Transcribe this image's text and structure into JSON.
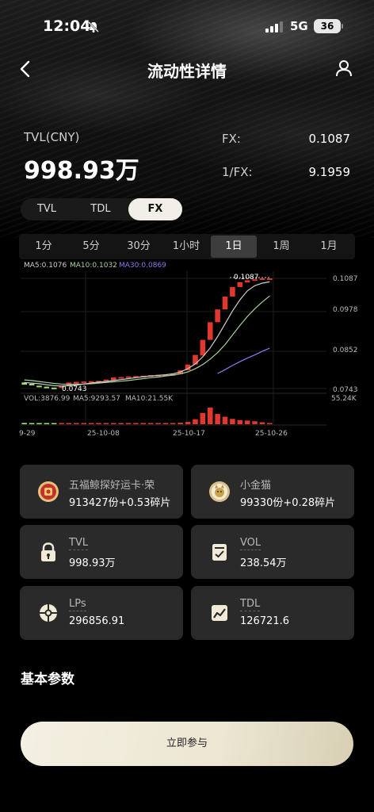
{
  "status_bar": {
    "time": "12:04",
    "network": "5G",
    "battery": "36"
  },
  "header": {
    "title": "流动性详情"
  },
  "stats": {
    "tvl_label": "TVL(CNY)",
    "tvl_value": "998.93万",
    "fx_label": "FX:",
    "fx_value": "0.1087",
    "inv_fx_label": "1/FX:",
    "inv_fx_value": "9.1959"
  },
  "segment_tabs": [
    {
      "label": "TVL",
      "active": false
    },
    {
      "label": "TDL",
      "active": false
    },
    {
      "label": "FX",
      "active": true
    }
  ],
  "intervals": [
    {
      "label": "1分",
      "active": false
    },
    {
      "label": "5分",
      "active": false
    },
    {
      "label": "30分",
      "active": false
    },
    {
      "label": "1小时",
      "active": false
    },
    {
      "label": "1日",
      "active": true
    },
    {
      "label": "1周",
      "active": false
    },
    {
      "label": "1月",
      "active": false
    }
  ],
  "chart_data": {
    "type": "candlestick",
    "colors": {
      "up": "#e0382f",
      "down": "#9be36a",
      "ma5": "#cfcfcf",
      "ma10": "#a6d39a",
      "ma30": "#8c7cf0",
      "grid": "#1e1e1e"
    },
    "ma_legend": {
      "ma5": "MA5:0.1076",
      "ma10": "MA10:0.1032",
      "ma30": "MA30:0.0869"
    },
    "y_ticks": [
      "0.1087",
      "0.0978",
      "0.0852",
      "0.0743"
    ],
    "ylim": [
      0.0743,
      0.1087
    ],
    "max_label": "0.1087",
    "min_label": "0.0743",
    "volume_legend": {
      "vol": "VOL:3876.99",
      "ma5": "MA5:9293.57",
      "ma10": "MA10:21.55K"
    },
    "volume_max_label": "55.24K",
    "x_ticks": [
      "9-29",
      "25-10-08",
      "25-10-17",
      "25-10-26"
    ],
    "candles": [
      {
        "o": 0.0762,
        "c": 0.0755
      },
      {
        "o": 0.0758,
        "c": 0.0753
      },
      {
        "o": 0.0752,
        "c": 0.0747
      },
      {
        "o": 0.0749,
        "c": 0.0745
      },
      {
        "o": 0.0746,
        "c": 0.0744
      },
      {
        "o": 0.0745,
        "c": 0.0751
      },
      {
        "o": 0.0752,
        "c": 0.0762
      },
      {
        "o": 0.0758,
        "c": 0.0764
      },
      {
        "o": 0.0762,
        "c": 0.0765
      },
      {
        "o": 0.0764,
        "c": 0.0766
      },
      {
        "o": 0.0765,
        "c": 0.0767
      },
      {
        "o": 0.0766,
        "c": 0.0771
      },
      {
        "o": 0.0769,
        "c": 0.0778
      },
      {
        "o": 0.0776,
        "c": 0.0779
      },
      {
        "o": 0.0777,
        "c": 0.0781
      },
      {
        "o": 0.0779,
        "c": 0.0782
      },
      {
        "o": 0.0781,
        "c": 0.0783
      },
      {
        "o": 0.0782,
        "c": 0.0785
      },
      {
        "o": 0.0784,
        "c": 0.0786
      },
      {
        "o": 0.0785,
        "c": 0.0787
      },
      {
        "o": 0.0786,
        "c": 0.0788
      },
      {
        "o": 0.0788,
        "c": 0.08
      },
      {
        "o": 0.08,
        "c": 0.0818
      },
      {
        "o": 0.0818,
        "c": 0.0848
      },
      {
        "o": 0.0846,
        "c": 0.0895
      },
      {
        "o": 0.0895,
        "c": 0.095
      },
      {
        "o": 0.095,
        "c": 0.099
      },
      {
        "o": 0.099,
        "c": 0.103
      },
      {
        "o": 0.103,
        "c": 0.106
      },
      {
        "o": 0.106,
        "c": 0.1075
      },
      {
        "o": 0.1074,
        "c": 0.1081
      },
      {
        "o": 0.108,
        "c": 0.1084
      },
      {
        "o": 0.1083,
        "c": 0.1087
      },
      {
        "o": 0.1086,
        "c": 0.1087
      }
    ],
    "ma5": [
      0.0762,
      0.076,
      0.0758,
      0.0755,
      0.0752,
      0.0751,
      0.0752,
      0.0754,
      0.0757,
      0.076,
      0.0763,
      0.0765,
      0.0768,
      0.0771,
      0.0774,
      0.0777,
      0.078,
      0.0782,
      0.0784,
      0.0786,
      0.0789,
      0.0795,
      0.0805,
      0.082,
      0.0842,
      0.087,
      0.0905,
      0.0945,
      0.0985,
      0.102,
      0.1048,
      0.1064,
      0.1072,
      0.1076
    ],
    "ma10": [
      0.077,
      0.0768,
      0.0765,
      0.0762,
      0.0759,
      0.0757,
      0.0756,
      0.0756,
      0.0757,
      0.0758,
      0.076,
      0.0762,
      0.0764,
      0.0766,
      0.0768,
      0.0771,
      0.0774,
      0.0777,
      0.0779,
      0.0782,
      0.0785,
      0.0789,
      0.0795,
      0.0805,
      0.0818,
      0.0835,
      0.0855,
      0.088,
      0.091,
      0.094,
      0.0968,
      0.0992,
      0.1013,
      0.1032
    ],
    "ma30": [
      null,
      null,
      null,
      null,
      null,
      null,
      null,
      null,
      null,
      null,
      null,
      null,
      null,
      null,
      null,
      null,
      null,
      null,
      null,
      null,
      null,
      null,
      null,
      null,
      null,
      null,
      0.079,
      0.0802,
      0.0815,
      0.0827,
      0.0838,
      0.0848,
      0.0859,
      0.0869
    ],
    "volumes": [
      0.08,
      0.06,
      0.05,
      0.05,
      0.04,
      0.05,
      0.07,
      0.05,
      0.04,
      0.04,
      0.04,
      0.05,
      0.06,
      0.05,
      0.05,
      0.05,
      0.05,
      0.05,
      0.05,
      0.05,
      0.06,
      0.09,
      0.14,
      0.3,
      0.68,
      1.0,
      0.62,
      0.45,
      0.32,
      0.25,
      0.22,
      0.18,
      0.12,
      0.07
    ]
  },
  "cards": [
    {
      "label": "五福鲸探好运卡·荣",
      "value": "913427份+0.53碎片",
      "icon": "fortune-card-icon"
    },
    {
      "label": "小金猫",
      "value": "99330份+0.28碎片",
      "icon": "golden-cat-icon"
    },
    {
      "label": "TVL",
      "value": "998.93万",
      "icon": "lock-icon"
    },
    {
      "label": "VOL",
      "value": "238.54万",
      "icon": "volume-doc-icon"
    },
    {
      "label": "LPs",
      "value": "296856.91",
      "icon": "lp-ring-icon"
    },
    {
      "label": "TDL",
      "value": "126721.6",
      "icon": "trend-chart-icon"
    }
  ],
  "section": {
    "basic_params": "基本参数"
  },
  "cta": {
    "label": "立即参与"
  }
}
